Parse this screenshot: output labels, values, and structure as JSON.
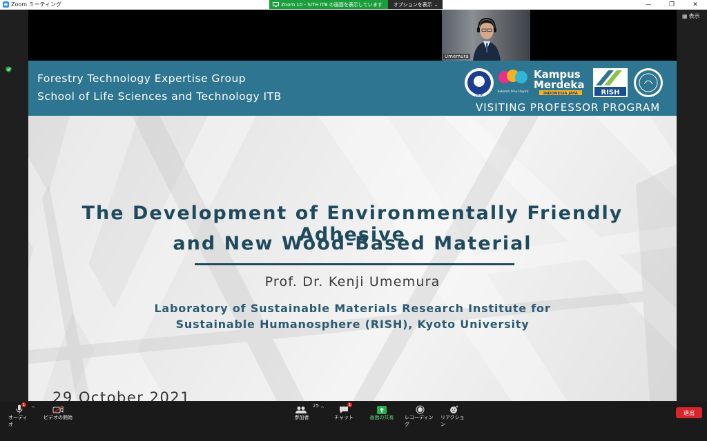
{
  "window": {
    "title": "Zoom ミーティング",
    "controls": {
      "minimize": "—",
      "restore": "❐",
      "close": "✕"
    }
  },
  "share_banner": {
    "status": "Zoom 10 - SITH ITB の画面を表示しています",
    "options": "オプションを表示"
  },
  "participant_video": {
    "name": "Umemura"
  },
  "view_button": {
    "label": "表示"
  },
  "slide": {
    "header_line1": "Forestry Technology Expertise Group",
    "header_line2": "School of Life Sciences and Technology ITB",
    "program": "VISITING PROFESSOR PROGRAM",
    "logos": {
      "kampus": "Kampus",
      "merdeka": "Merdeka",
      "indonesia_jaya": "INDONESIA JAYA",
      "rish": "RISH",
      "itb_year": "1920",
      "sith_caption": "Sekolah Ilmu Hayati"
    },
    "title_line1": "The Development of Environmentally Friendly Adhesive",
    "title_line2": "and New Wood-Based Material",
    "author": "Prof. Dr. Kenji Umemura",
    "affiliation_line1": "Laboratory of Sustainable Materials Research Institute for",
    "affiliation_line2": "Sustainable Humanosphere (RISH), Kyoto University",
    "date": "29 October 2021"
  },
  "toolbar": {
    "audio": {
      "label": "オーディオ",
      "badge": "1"
    },
    "video": {
      "label": "ビデオの開始"
    },
    "participants": {
      "label": "参加者",
      "count": "25"
    },
    "chat": {
      "label": "チャット",
      "badge": "1"
    },
    "share": {
      "label": "画面の共有"
    },
    "record": {
      "label": "レコーディング"
    },
    "reactions": {
      "label": "リアクション"
    },
    "leave": {
      "label": "退出"
    }
  },
  "colors": {
    "slide_header": "#2e7591",
    "title_text": "#1f4a5e",
    "share_green": "#1a9e3c",
    "leave_red": "#d6262b"
  }
}
